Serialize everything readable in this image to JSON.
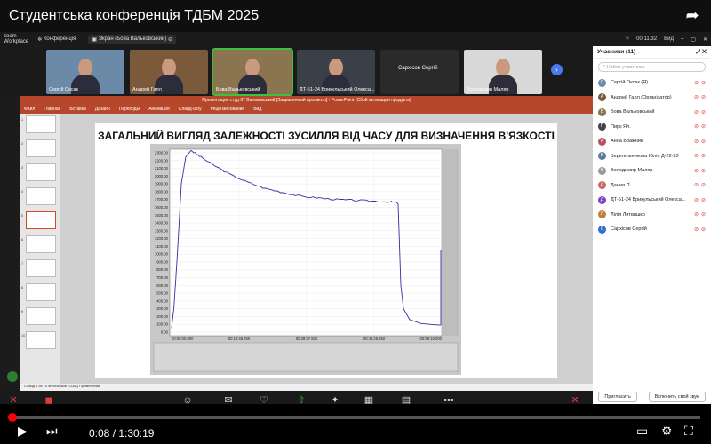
{
  "youtube": {
    "title": "Студентська конференція ТДБМ 2025",
    "current_time": "0:08",
    "duration": "1:30:19",
    "progress": 0.0015
  },
  "zoom_top": {
    "logo_line1": "zoom",
    "logo_line2": "Workplace",
    "conference": "Конференція",
    "screen_share": "Экран (Бова Вальковський)",
    "time": "00:11:32",
    "view": "Вид"
  },
  "tiles": [
    {
      "name": "Сергій Оксак",
      "bg": "#6b8aa8"
    },
    {
      "name": "Андрей Галл",
      "bg": "#7a5a3a"
    },
    {
      "name": "Бова Вальковський",
      "bg": "#8a7550"
    },
    {
      "name": "ДТ-51-24 Брикульський Олекса...",
      "bg": "#3a3f48"
    },
    {
      "name": "Сархісов Сергій",
      "bg": "#2a2a2a"
    },
    {
      "name": "Володимир Маляр",
      "bg": "#d8d8d8"
    }
  ],
  "participants": {
    "header": "Учасники (11)",
    "search_placeholder": "Найти участника",
    "items": [
      {
        "name": "Сергій Оксак (Я)",
        "initial": "С",
        "color": "#6b8aa8"
      },
      {
        "name": "Андрей Галл (Організатор)",
        "initial": "А",
        "color": "#7a5a3a"
      },
      {
        "name": "Бова Вальковський",
        "initial": "Б",
        "color": "#8a7550"
      },
      {
        "name": "Пирк Ял.",
        "initial": "П",
        "color": "#444"
      },
      {
        "name": "Анна Бражник",
        "initial": "А",
        "color": "#b5525e"
      },
      {
        "name": "Берегельникова Юлія Д-22-23",
        "initial": "Б",
        "color": "#5a7a9a"
      },
      {
        "name": "Володимир Маляр",
        "initial": "В",
        "color": "#999"
      },
      {
        "name": "Данил П",
        "initial": "Д",
        "color": "#c66"
      },
      {
        "name": "ДТ-51-24 Брикульський Олекса...",
        "initial": "Д",
        "color": "#7b3fc4"
      },
      {
        "name": "Лілія Литвишко",
        "initial": "Л",
        "color": "#c08040"
      },
      {
        "name": "Сархісов Сергій",
        "initial": "С",
        "color": "#2f6fd6"
      }
    ],
    "invite": "Пригласить",
    "unmute_self": "Включить свой звук"
  },
  "ppt": {
    "title_bar": "Презентация студ 67 Вальковський [Защищенный просмотр] - PowerPoint (Сбой активации продукта)",
    "tabs": [
      "Файл",
      "Главная",
      "Вставка",
      "Дизайн",
      "Переходы",
      "Анимация",
      "Слайд-шоу",
      "Рецензирование",
      "Вид"
    ],
    "status": "Слайд 5 из 10   английский (США)   Примечания",
    "slide_title": "ЗАГАЛЬНИЙ ВИГЛЯД ЗАЛЕЖНОСТІ ЗУСИЛЛЯ ВІД ЧАСУ ДЛЯ ВИЗНАЧЕННЯ В'ЯЗКОСТІ",
    "thumb_numbers": [
      "1",
      "2",
      "3",
      "4",
      "5",
      "6",
      "7",
      "8",
      "9",
      "10"
    ]
  },
  "chart": {
    "yticks": [
      "2300.00",
      "2200.00",
      "2100.00",
      "2000.00",
      "1900.00",
      "1800.00",
      "1700.00",
      "1600.00",
      "1500.00",
      "1400.00",
      "1300.00",
      "1200.00",
      "1100.00",
      "1000.00",
      "900.00",
      "800.00",
      "700.00",
      "600.00",
      "500.00",
      "400.00",
      "300.00",
      "200.00",
      "100.00",
      "0.00"
    ],
    "xticks": [
      "00:00:00.000",
      "00:14:46.750",
      "00:29:37.500",
      "00:44:26.250",
      "00:59:15.000"
    ]
  },
  "toolbar": [
    {
      "label": "Звук",
      "icon": "✕",
      "color": "red"
    },
    {
      "label": "Видео",
      "icon": "◼",
      "color": "red"
    },
    {
      "label": "Участники",
      "icon": "☺",
      "color": ""
    },
    {
      "label": "Чат",
      "icon": "✉",
      "color": ""
    },
    {
      "label": "Отреагировать",
      "icon": "♡",
      "color": ""
    },
    {
      "label": "Поделиться",
      "icon": "⇧",
      "color": "green"
    },
    {
      "label": "AI Companion",
      "icon": "✦",
      "color": ""
    },
    {
      "label": "Приложения",
      "icon": "▦",
      "color": ""
    },
    {
      "label": "Доски сообщений",
      "icon": "▤",
      "color": ""
    },
    {
      "label": "Дополнительно",
      "icon": "•••",
      "color": ""
    },
    {
      "label": "Выйти",
      "icon": "✕",
      "color": "red"
    }
  ]
}
